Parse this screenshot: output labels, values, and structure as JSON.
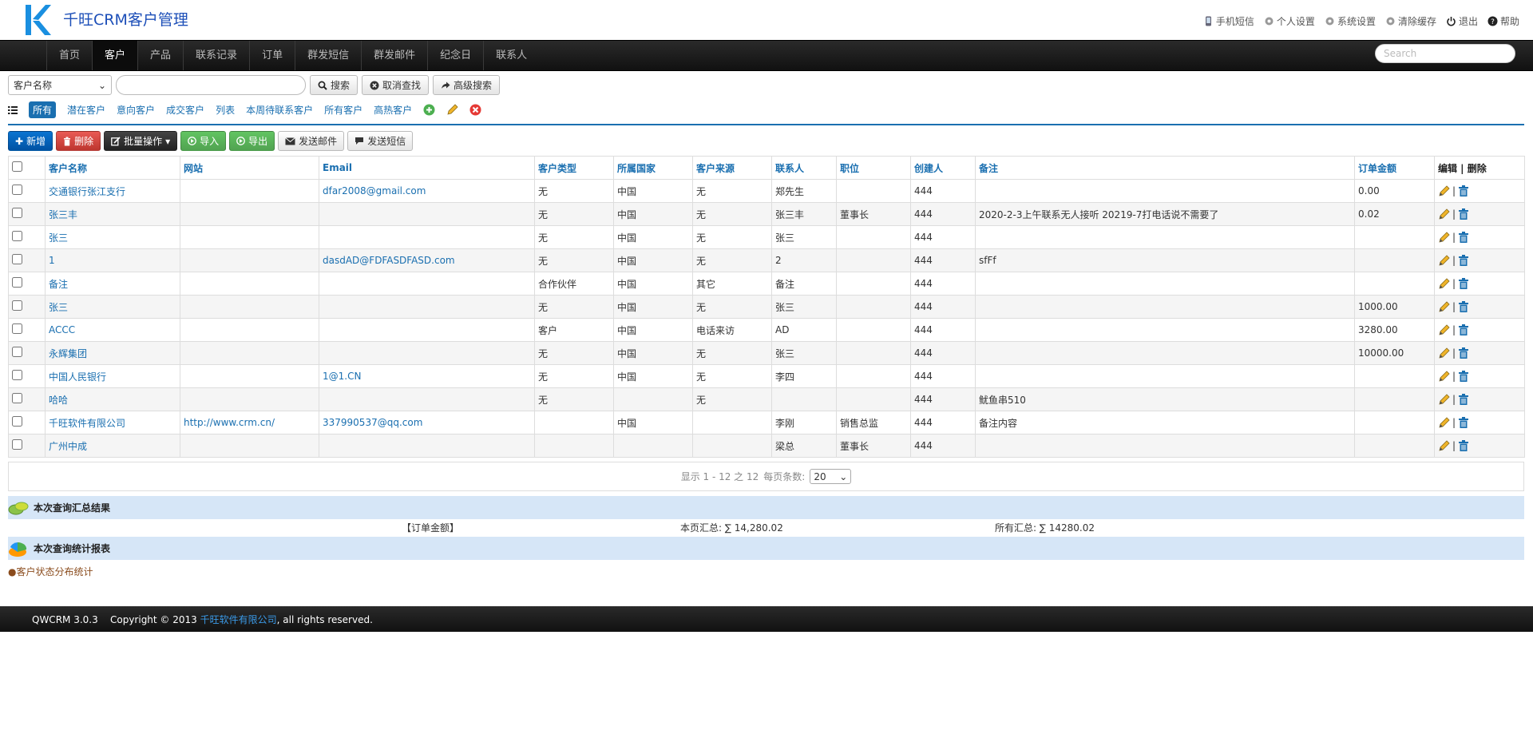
{
  "header": {
    "app_title": "千旺CRM客户管理",
    "top_links": [
      {
        "label": "手机短信",
        "icon": "phone-icon"
      },
      {
        "label": "个人设置",
        "icon": "gear-icon"
      },
      {
        "label": "系统设置",
        "icon": "gear-icon"
      },
      {
        "label": "清除缓存",
        "icon": "gear-icon"
      },
      {
        "label": "退出",
        "icon": "power-icon"
      },
      {
        "label": "帮助",
        "icon": "help-icon"
      }
    ]
  },
  "nav": {
    "items": [
      "首页",
      "客户",
      "产品",
      "联系记录",
      "订单",
      "群发短信",
      "群发邮件",
      "纪念日",
      "联系人"
    ],
    "active_index": 1,
    "search_placeholder": "Search"
  },
  "search": {
    "field_select": "客户名称",
    "search_label": "搜索",
    "cancel_label": "取消查找",
    "advanced_label": "高级搜索"
  },
  "filters": {
    "items": [
      "所有",
      "潜在客户",
      "意向客户",
      "成交客户",
      "列表",
      "本周待联系客户",
      "所有客户",
      "高热客户"
    ],
    "active_index": 0
  },
  "actions": {
    "new": "新增",
    "delete": "删除",
    "batch": "批量操作",
    "import": "导入",
    "export": "导出",
    "send_email": "发送邮件",
    "send_sms": "发送短信"
  },
  "table": {
    "headers": [
      "客户名称",
      "网站",
      "Email",
      "客户类型",
      "所属国家",
      "客户来源",
      "联系人",
      "职位",
      "创建人",
      "备注",
      "订单金额",
      "编辑 | 删除"
    ],
    "rows": [
      [
        "交通银行张江支行",
        "",
        "dfar2008@gmail.com",
        "无",
        "中国",
        "无",
        "郑先生",
        "",
        "444",
        "",
        "0.00"
      ],
      [
        "张三丰",
        "",
        "",
        "无",
        "中国",
        "无",
        "张三丰",
        "董事长",
        "444",
        "2020-2-3上午联系无人接听 20219-7打电话说不需要了",
        "0.02"
      ],
      [
        "张三",
        "",
        "",
        "无",
        "中国",
        "无",
        "张三",
        "",
        "444",
        "",
        ""
      ],
      [
        "1",
        "",
        "dasdAD@FDFASDFASD.com",
        "无",
        "中国",
        "无",
        "2",
        "",
        "444",
        "sfFf",
        ""
      ],
      [
        "备注",
        "",
        "",
        "合作伙伴",
        "中国",
        "其它",
        "备注",
        "",
        "444",
        "",
        ""
      ],
      [
        "张三",
        "",
        "",
        "无",
        "中国",
        "无",
        "张三",
        "",
        "444",
        "",
        "1000.00"
      ],
      [
        "ACCC",
        "",
        "",
        "客户",
        "中国",
        "电话来访",
        "AD",
        "",
        "444",
        "",
        "3280.00"
      ],
      [
        "永辉集团",
        "",
        "",
        "无",
        "中国",
        "无",
        "张三",
        "",
        "444",
        "",
        "10000.00"
      ],
      [
        "中国人民银行",
        "",
        "1@1.CN",
        "无",
        "中国",
        "无",
        "李四",
        "",
        "444",
        "",
        ""
      ],
      [
        "哈哈",
        "",
        "",
        "无",
        "",
        "无",
        "",
        "",
        "444",
        "鱿鱼串510",
        ""
      ],
      [
        "千旺软件有限公司",
        "http://www.crm.cn/",
        "337990537@qq.com",
        "",
        "中国",
        "",
        "李刚",
        "销售总监",
        "444",
        "备注内容",
        ""
      ],
      [
        "广州中成",
        "",
        "",
        "",
        "",
        "",
        "梁总",
        "董事长",
        "444",
        "",
        ""
      ]
    ]
  },
  "pager": {
    "info": "显示 1 - 12 之 12",
    "per_page_label": "每页条数:",
    "per_page_value": "20"
  },
  "summary": {
    "title": "本次查询汇总结果",
    "field": "【订单金额】",
    "page_total": "本页汇总: ∑ 14,280.02",
    "all_total": "所有汇总: ∑ 14280.02"
  },
  "stats": {
    "title": "本次查询统计报表",
    "link": "●客户状态分布统计"
  },
  "footer": {
    "prefix": "QWCRM 3.0.3    Copyright © 2013 ",
    "company": "千旺软件有限公司",
    "suffix": ", all rights reserved."
  },
  "colors": {
    "accent": "#1a6fb0",
    "navbar": "#1b1b1b",
    "summary_bar": "#d6e6f7",
    "danger": "#bd362f",
    "success": "#51a351"
  }
}
